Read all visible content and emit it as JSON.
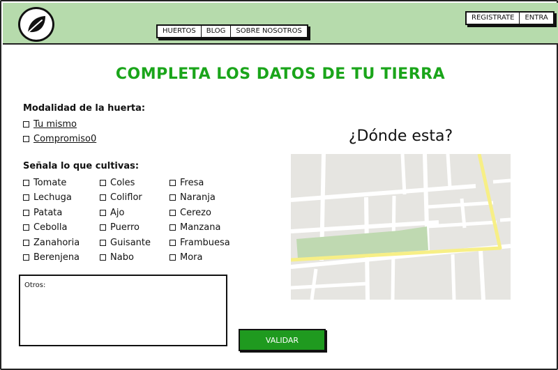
{
  "nav": {
    "items": [
      "HUERTOS",
      "BLOG",
      "SOBRE NOSOTROS"
    ]
  },
  "auth": {
    "register_label": "REGISTRATE",
    "login_label": "ENTRA"
  },
  "form": {
    "title": "COMPLETA LOS DATOS DE TU TIERRA",
    "modalidad_label": "Modalidad de la huerta:",
    "modalidad_options": [
      "Tu mismo",
      "Compromiso0"
    ],
    "cultivos_label": "Señala lo que cultivas:",
    "cultivos_col1": [
      "Tomate",
      "Lechuga",
      "Patata",
      "Cebolla",
      "Zanahoria",
      "Berenjena"
    ],
    "cultivos_col2": [
      "Coles",
      "Coliflor",
      "Ajo",
      "Puerro",
      "Guisante",
      "Nabo"
    ],
    "cultivos_col3": [
      "Fresa",
      "Naranja",
      "Cerezo",
      "Manzana",
      "Frambuesa",
      "Mora"
    ],
    "otros_placeholder": "Otros:",
    "submit_label": "VALIDAR"
  },
  "map_section": {
    "title": "¿Dónde esta?"
  },
  "colors": {
    "header_bg": "#b6dbac",
    "title": "#1aa51a",
    "button": "#1f9a1f",
    "map_bg": "#e6e5e1",
    "map_park": "#bfd9b1",
    "map_road": "#f7ef86"
  },
  "icons": {
    "logo": "leaf-icon"
  }
}
